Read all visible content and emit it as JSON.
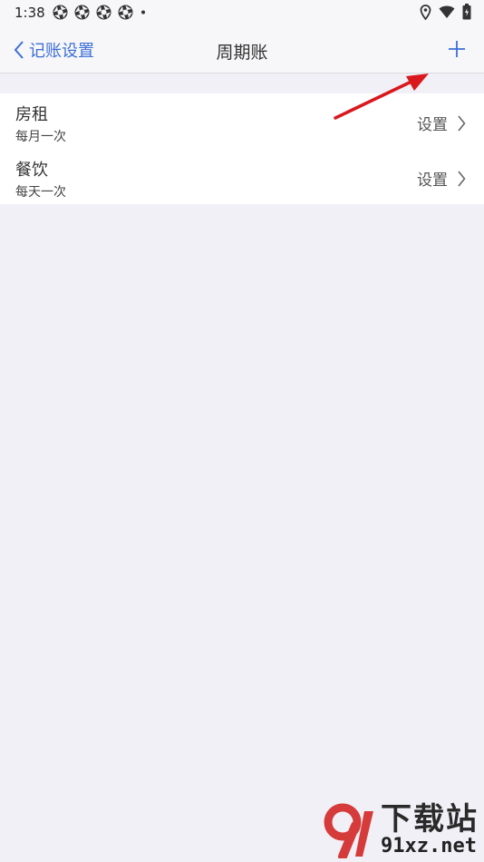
{
  "status": {
    "time": "1:38",
    "left_icons": [
      "app-icon",
      "app-icon",
      "app-icon",
      "app-icon",
      "dot-icon"
    ],
    "right_icons": [
      "location-icon",
      "wifi-icon",
      "battery-icon"
    ]
  },
  "nav": {
    "back_label": "记账设置",
    "title": "周期账",
    "add_icon": "plus-icon"
  },
  "list": {
    "items": [
      {
        "title": "房租",
        "subtitle": "每月一次",
        "action": "设置"
      },
      {
        "title": "餐饮",
        "subtitle": "每天一次",
        "action": "设置"
      }
    ]
  },
  "watermark": {
    "line1": "下载站",
    "line2": "91xz.net"
  },
  "colors": {
    "accent": "#3c6fd8",
    "background": "#f1f0f6",
    "arrow": "#d9181e"
  }
}
